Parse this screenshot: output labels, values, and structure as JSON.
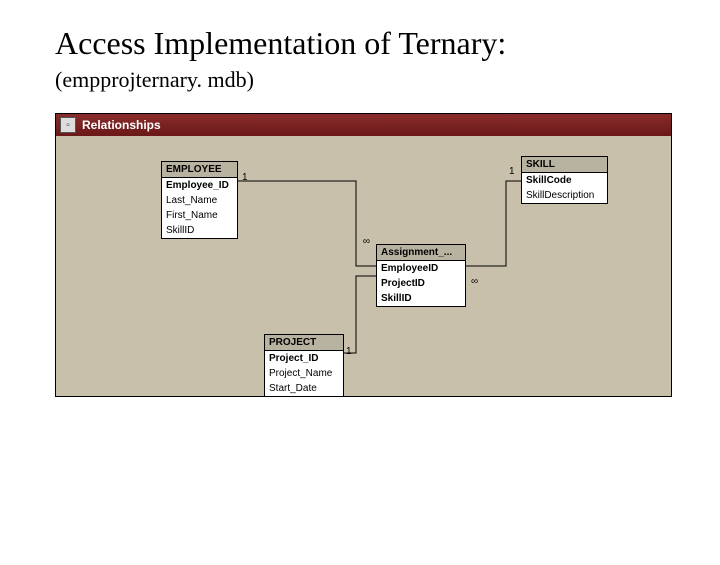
{
  "title": "Access Implementation of Ternary:",
  "subtitle": "(empprojternary. mdb)",
  "window": {
    "title": "Relationships"
  },
  "tables": {
    "employee": {
      "header": "EMPLOYEE",
      "fields": [
        "Employee_ID",
        "Last_Name",
        "First_Name",
        "SkillID"
      ]
    },
    "skill": {
      "header": "SKILL",
      "fields": [
        "SkillCode",
        "SkillDescription"
      ]
    },
    "assignment": {
      "header": "Assignment_...",
      "fields": [
        "EmployeeID",
        "ProjectID",
        "SkillID"
      ]
    },
    "project": {
      "header": "PROJECT",
      "fields": [
        "Project_ID",
        "Project_Name",
        "Start_Date"
      ]
    }
  },
  "relations": {
    "one_a": "1",
    "one_b": "1",
    "one_c": "1",
    "inf_a": "∞",
    "inf_b": "∞"
  }
}
